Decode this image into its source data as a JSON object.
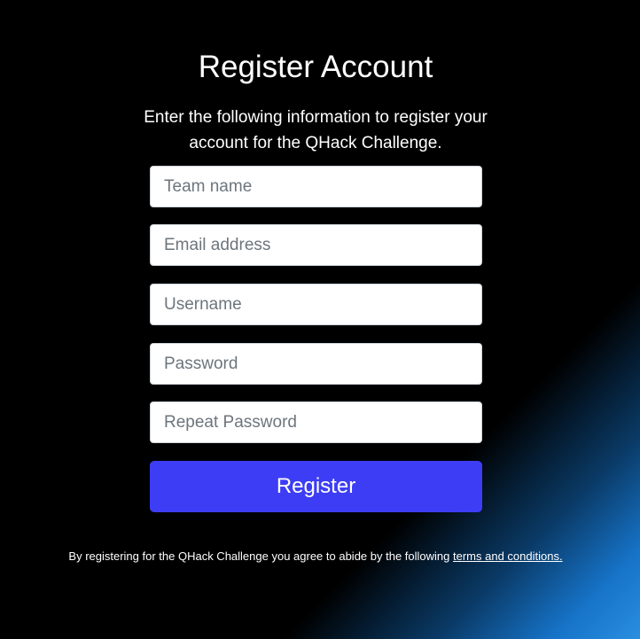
{
  "page": {
    "title": "Register Account",
    "subtitle": "Enter the following information to register your account for the QHack Challenge."
  },
  "form": {
    "team_name_placeholder": "Team name",
    "email_placeholder": "Email address",
    "username_placeholder": "Username",
    "password_placeholder": "Password",
    "repeat_password_placeholder": "Repeat Password",
    "submit_label": "Register"
  },
  "footer": {
    "terms_prefix": "By registering for the QHack Challenge you agree to abide by the following ",
    "terms_link": "terms and conditions."
  },
  "colors": {
    "background": "#000000",
    "accent": "#3d3df5",
    "corner_glow": "#2a8fe0"
  }
}
